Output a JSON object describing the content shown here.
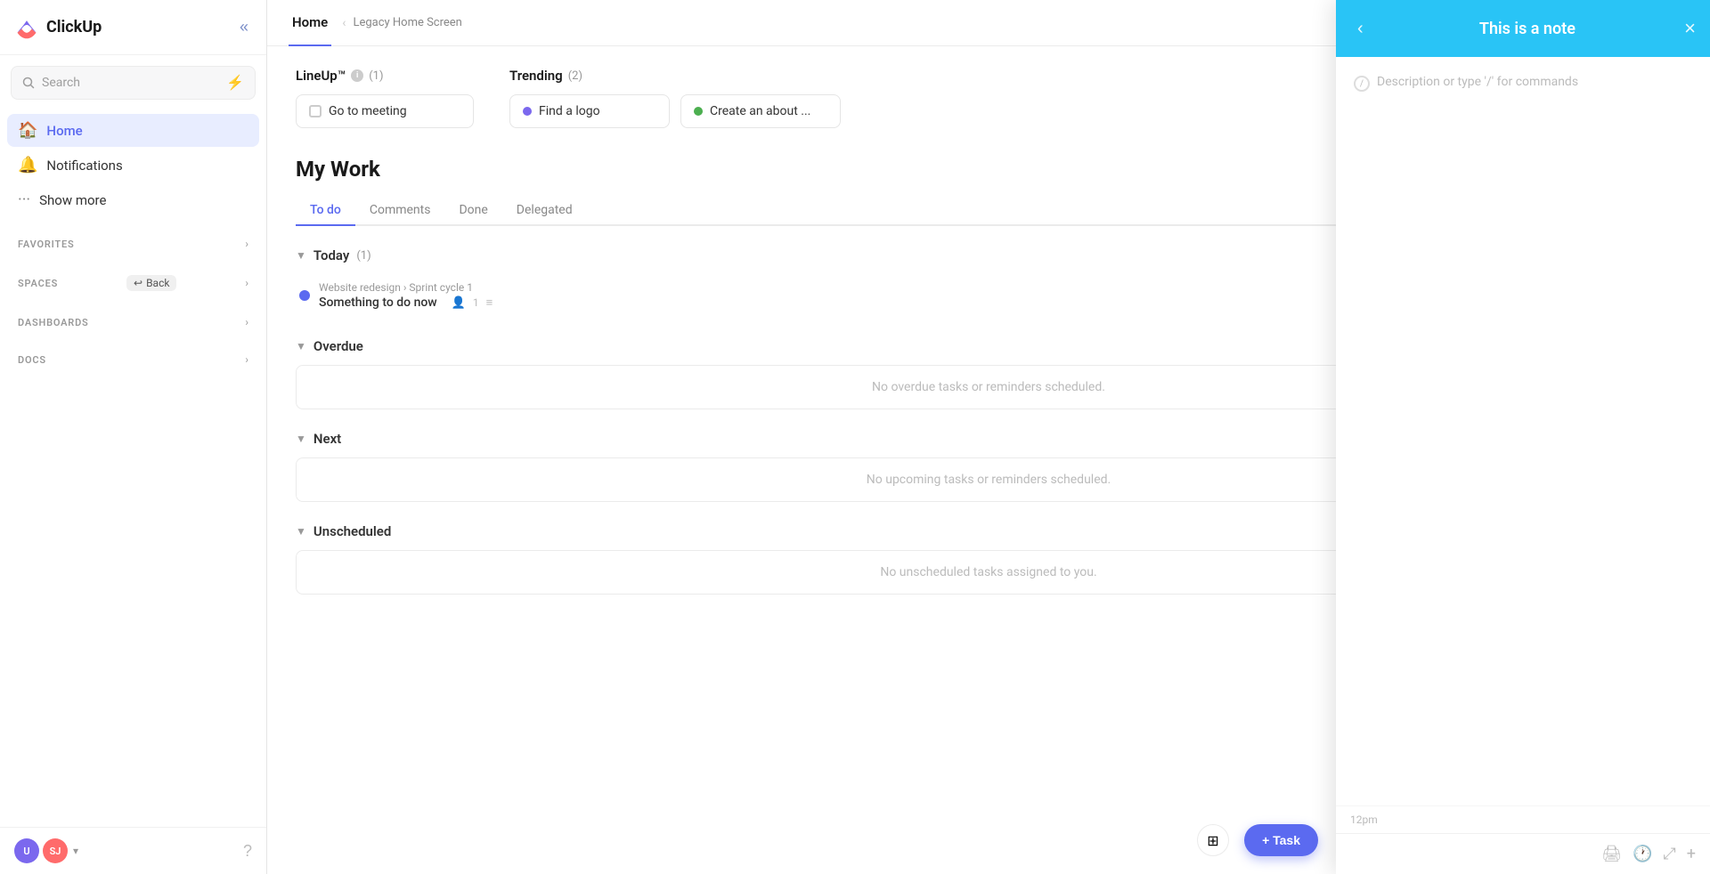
{
  "app": {
    "name": "ClickUp"
  },
  "sidebar": {
    "collapse_label": "«",
    "search_placeholder": "Search",
    "nav_items": [
      {
        "id": "home",
        "label": "Home",
        "icon": "🏠",
        "active": true
      },
      {
        "id": "notifications",
        "label": "Notifications",
        "icon": "🔔",
        "active": false
      },
      {
        "id": "show-more",
        "label": "Show more",
        "icon": "⋯",
        "active": false
      }
    ],
    "sections": [
      {
        "id": "favorites",
        "label": "FAVORITES",
        "has_back": false
      },
      {
        "id": "spaces",
        "label": "SPACES",
        "has_back": true,
        "back_label": "Back"
      },
      {
        "id": "dashboards",
        "label": "DASHBOARDS",
        "has_back": false
      },
      {
        "id": "docs",
        "label": "DOCS",
        "has_back": false
      }
    ],
    "avatars": [
      {
        "id": "u",
        "label": "U",
        "color": "#7b68ee"
      },
      {
        "id": "sj",
        "label": "SJ",
        "color": "#ff6b6b"
      }
    ],
    "help_label": "?"
  },
  "topbar": {
    "tab_home": "Home",
    "breadcrumb_sep": "‹",
    "breadcrumb_label": "Legacy Home Screen"
  },
  "lineup": {
    "title": "LineUp™",
    "info": "i",
    "count": "(1)",
    "task": {
      "label": "Go to meeting"
    }
  },
  "trending": {
    "title": "Trending",
    "count": "(2)",
    "items": [
      {
        "id": "find-logo",
        "label": "Find a logo",
        "dot_color": "#7b68ee"
      },
      {
        "id": "create-about",
        "label": "Create an about ...",
        "dot_color": "#4caf50"
      }
    ]
  },
  "my_work": {
    "title": "My Work",
    "tabs": [
      {
        "id": "todo",
        "label": "To do",
        "active": true
      },
      {
        "id": "comments",
        "label": "Comments",
        "active": false
      },
      {
        "id": "done",
        "label": "Done",
        "active": false
      },
      {
        "id": "delegated",
        "label": "Delegated",
        "active": false
      }
    ],
    "sections": [
      {
        "id": "today",
        "label": "Today",
        "count": "(1)",
        "collapsed": false,
        "tasks": [
          {
            "id": "task1",
            "breadcrumb": "Website redesign › Sprint cycle 1",
            "name": "Something to do now",
            "meta_assignees": "1",
            "has_subtasks": true
          }
        ],
        "empty": false
      },
      {
        "id": "overdue",
        "label": "Overdue",
        "count": "",
        "collapsed": false,
        "tasks": [],
        "empty": true,
        "empty_text": "No overdue tasks or reminders scheduled."
      },
      {
        "id": "next",
        "label": "Next",
        "count": "",
        "collapsed": false,
        "tasks": [],
        "empty": true,
        "empty_text": "No upcoming tasks or reminders scheduled."
      },
      {
        "id": "unscheduled",
        "label": "Unscheduled",
        "count": "",
        "collapsed": false,
        "tasks": [],
        "empty": true,
        "empty_text": "No unscheduled tasks assigned to you."
      }
    ]
  },
  "note_panel": {
    "title": "This is a note",
    "placeholder": "Description or type '/' for commands",
    "nav_prev": "‹",
    "nav_close": "×",
    "footer_icons": [
      "🖨",
      "🕐",
      "⤢",
      "+"
    ],
    "time_label": "12pm"
  },
  "fab": {
    "task_label": "+ Task",
    "apps_icon": "⊞"
  }
}
